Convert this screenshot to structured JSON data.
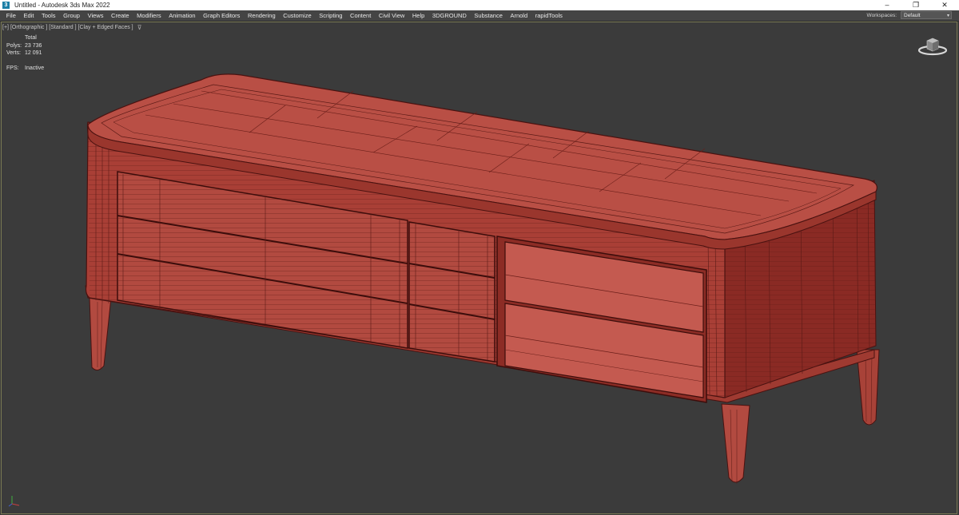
{
  "titlebar": {
    "title": "Untitled - Autodesk 3ds Max 2022",
    "app_icon": "3ds-max-icon",
    "controls": [
      "–",
      "❐",
      "✕"
    ]
  },
  "menubar": {
    "items": [
      "File",
      "Edit",
      "Tools",
      "Group",
      "Views",
      "Create",
      "Modifiers",
      "Animation",
      "Graph Editors",
      "Rendering",
      "Customize",
      "Scripting",
      "Content",
      "Civil View",
      "Help",
      "3DGROUND",
      "Substance",
      "Arnold",
      "rapidTools"
    ],
    "workspaces_label": "Workspaces:",
    "workspaces_value": "Default"
  },
  "viewport": {
    "label_plus": "[+]",
    "label_view": "[Orthographic ]",
    "label_shading": "[Standard ]",
    "label_mode": "[Clay + Edged Faces ]",
    "stats": {
      "header": "Total",
      "polys_label": "Polys:",
      "polys_value": "23 736",
      "verts_label": "Verts:",
      "verts_value": "12 091",
      "fps_label": "FPS:",
      "fps_value": "Inactive"
    },
    "colors": {
      "clay_fill": "#b5493f",
      "clay_dark": "#7a2520",
      "wire": "#4a1210",
      "background": "#3b3b3b"
    }
  }
}
